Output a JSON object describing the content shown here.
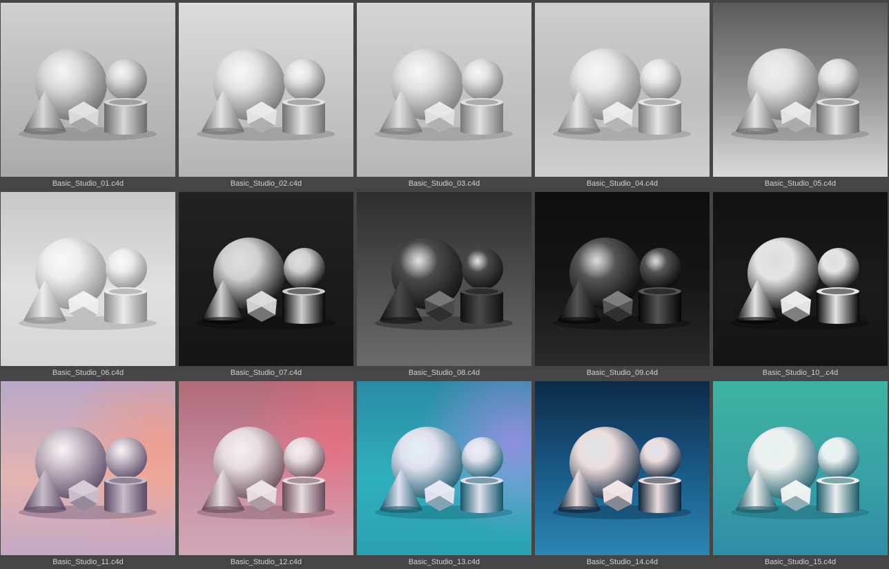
{
  "items": [
    {
      "label": "Basic_Studio_01.c4d",
      "style": {
        "top": "#d0d0d0",
        "mid": "#bababa",
        "floor": "#aaaaaa",
        "obj": "#d8d8d8",
        "shadow": "#6a6a6a",
        "tint": null
      }
    },
    {
      "label": "Basic_Studio_02.c4d",
      "style": {
        "top": "#dcdcdc",
        "mid": "#c6c6c6",
        "floor": "#b4b4b4",
        "obj": "#e2e2e2",
        "shadow": "#707070",
        "tint": null
      }
    },
    {
      "label": "Basic_Studio_03.c4d",
      "style": {
        "top": "#d4d4d4",
        "mid": "#c2c2c2",
        "floor": "#b8b8b8",
        "obj": "#e0e0e0",
        "shadow": "#777777",
        "tint": null
      }
    },
    {
      "label": "Basic_Studio_04.c4d",
      "style": {
        "top": "#cecece",
        "mid": "#bdbdbd",
        "floor": "#cfcfcf",
        "obj": "#e6e6e6",
        "shadow": "#7a7a7a",
        "tint": null
      }
    },
    {
      "label": "Basic_Studio_05.c4d",
      "style": {
        "top": "#5a5a5a",
        "mid": "#9a9a9a",
        "floor": "#dadada",
        "obj": "#e2e2e2",
        "shadow": "#6a6a6a",
        "tint": null
      }
    },
    {
      "label": "Basic_Studio_06.c4d",
      "style": {
        "top": "#c8c8c8",
        "mid": "#e0e0e0",
        "floor": "#d6d6d6",
        "obj": "#ececec",
        "shadow": "#8a8a8a",
        "tint": null
      }
    },
    {
      "label": "Basic_Studio_07.c4d",
      "style": {
        "top": "#222222",
        "mid": "#1a1a1a",
        "floor": "#151515",
        "obj": "#cfcfcf",
        "shadow": "#050505",
        "tint": null
      }
    },
    {
      "label": "Basic_Studio_08.c4d",
      "style": {
        "top": "#2e2e2e",
        "mid": "#505050",
        "floor": "#6a6a6a",
        "obj": "#4a4a4a",
        "shadow": "#101010",
        "tint": null
      }
    },
    {
      "label": "Basic_Studio_09.c4d",
      "style": {
        "top": "#0e0e0e",
        "mid": "#161616",
        "floor": "#2a2a2a",
        "obj": "#555555",
        "shadow": "#050505",
        "tint": null
      }
    },
    {
      "label": "Basic_Studio_10_.c4d",
      "style": {
        "top": "#121212",
        "mid": "#1a1a1a",
        "floor": "#141414",
        "obj": "#e4e4e4",
        "shadow": "#050505",
        "tint": null
      }
    },
    {
      "label": "Basic_Studio_11.c4d",
      "style": {
        "top": "#b8a8c8",
        "mid": "#e4b4b0",
        "floor": "#c4a8c4",
        "obj": "#c8bcc8",
        "shadow": "#5a4a66",
        "tint": "#ff9070"
      }
    },
    {
      "label": "Basic_Studio_12.c4d",
      "style": {
        "top": "#b06a78",
        "mid": "#c890a4",
        "floor": "#d0a8b8",
        "obj": "#e6dce0",
        "shadow": "#6a4a58",
        "tint": "#ff6070"
      }
    },
    {
      "label": "Basic_Studio_13.c4d",
      "style": {
        "top": "#2a8aa4",
        "mid": "#2fb0bc",
        "floor": "#2aa0b0",
        "obj": "#e0e0ee",
        "shadow": "#14586a",
        "tint": "#e080ff"
      }
    },
    {
      "label": "Basic_Studio_14.c4d",
      "style": {
        "top": "#0c2a48",
        "mid": "#1a5c8a",
        "floor": "#2a86b2",
        "obj": "#ecdcdc",
        "shadow": "#0a2238",
        "tint": null
      }
    },
    {
      "label": "Basic_Studio_15.c4d",
      "style": {
        "top": "#3cb4a0",
        "mid": "#3aa0a6",
        "floor": "#2e8ea6",
        "obj": "#eef0f0",
        "shadow": "#1a5a66",
        "tint": null
      }
    }
  ]
}
